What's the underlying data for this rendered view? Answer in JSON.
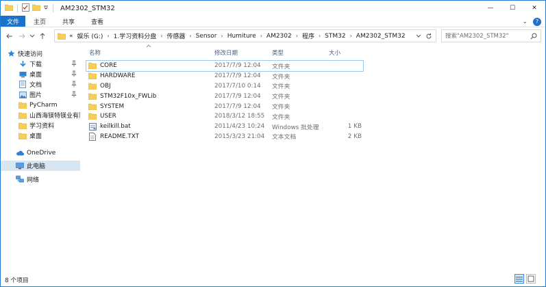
{
  "window": {
    "title": "AM2302_STM32",
    "minimize_glyph": "—",
    "maximize_glyph": "☐",
    "close_glyph": "✕"
  },
  "ribbon": {
    "file_tab": "文件",
    "tabs": [
      "主页",
      "共享",
      "查看"
    ],
    "collapse_glyph": "⌄",
    "help_glyph": "?"
  },
  "address": {
    "overflow": "«",
    "crumbs": [
      "娱乐 (G:)",
      "1.学习资料分盘",
      "传感器",
      "Sensor",
      "Humiture",
      "AM2302",
      "程序",
      "STM32",
      "AM2302_STM32"
    ]
  },
  "search": {
    "placeholder": "搜索\"AM2302_STM32\""
  },
  "sidebar": {
    "quick_access": "快速访问",
    "pinned": [
      {
        "label": "下载",
        "icon": "download-icon"
      },
      {
        "label": "桌面",
        "icon": "desktop-icon"
      },
      {
        "label": "文档",
        "icon": "documents-icon"
      },
      {
        "label": "图片",
        "icon": "pictures-icon"
      }
    ],
    "folders": [
      "PyCharm",
      "山西海镁特镁业有限",
      "学习资料",
      "桌面"
    ],
    "onedrive": "OneDrive",
    "this_pc": "此电脑",
    "network": "网络"
  },
  "columns": {
    "name": "名称",
    "date": "修改日期",
    "type": "类型",
    "size": "大小"
  },
  "files": [
    {
      "name": "CORE",
      "date": "2017/7/9 12:04",
      "type": "文件夹",
      "size": "",
      "kind": "folder"
    },
    {
      "name": "HARDWARE",
      "date": "2017/7/9 12:04",
      "type": "文件夹",
      "size": "",
      "kind": "folder"
    },
    {
      "name": "OBJ",
      "date": "2017/7/10 0:14",
      "type": "文件夹",
      "size": "",
      "kind": "folder"
    },
    {
      "name": "STM32F10x_FWLib",
      "date": "2017/7/9 12:04",
      "type": "文件夹",
      "size": "",
      "kind": "folder"
    },
    {
      "name": "SYSTEM",
      "date": "2017/7/9 12:04",
      "type": "文件夹",
      "size": "",
      "kind": "folder"
    },
    {
      "name": "USER",
      "date": "2018/3/12 18:55",
      "type": "文件夹",
      "size": "",
      "kind": "folder"
    },
    {
      "name": "keilkill.bat",
      "date": "2011/4/23 10:24",
      "type": "Windows 批处理",
      "size": "1 KB",
      "kind": "bat"
    },
    {
      "name": "README.TXT",
      "date": "2015/3/23 21:04",
      "type": "文本文档",
      "size": "2 KB",
      "kind": "txt"
    }
  ],
  "status": {
    "item_count": "8 个项目"
  },
  "colors": {
    "accent": "#1a73c8",
    "folder": "#f7cd5c",
    "selection": "#d8e6f2"
  }
}
